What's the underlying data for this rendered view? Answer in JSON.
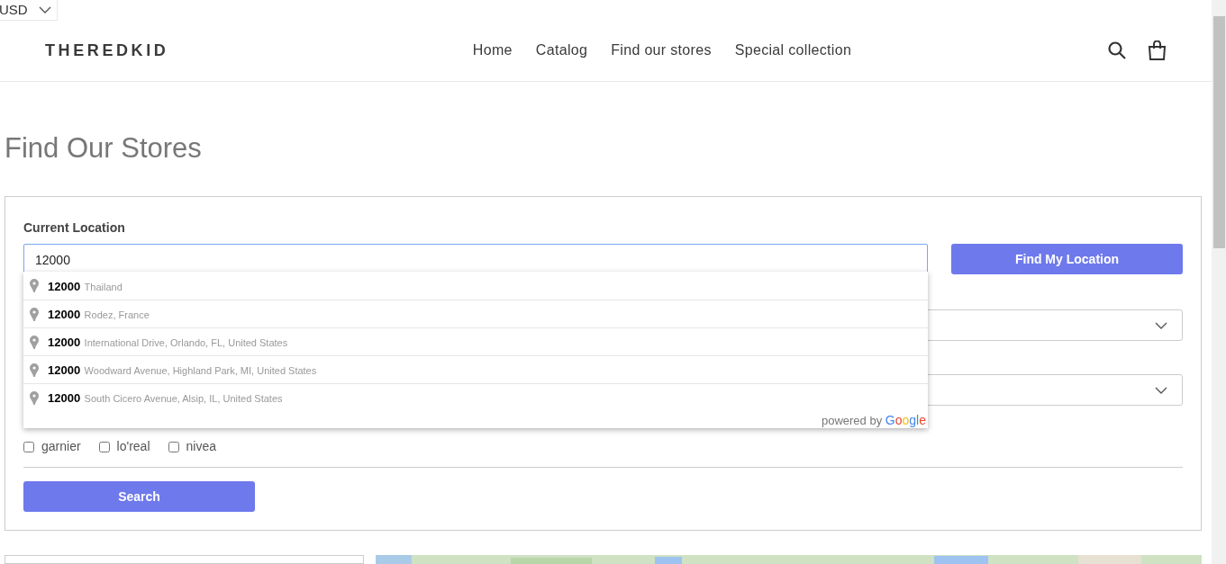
{
  "currency": {
    "value": "USD"
  },
  "header": {
    "logo": "THEREDKID",
    "nav": [
      {
        "label": "Home"
      },
      {
        "label": "Catalog"
      },
      {
        "label": "Find our stores"
      },
      {
        "label": "Special collection"
      }
    ]
  },
  "page_title": "Find Our Stores",
  "form": {
    "location_label": "Current Location",
    "location_value": "12000",
    "find_button": "Find My Location",
    "suggestions": [
      {
        "main": "12000",
        "secondary": "Thailand"
      },
      {
        "main": "12000",
        "secondary": "Rodez, France"
      },
      {
        "main": "12000",
        "secondary": "International Drive, Orlando, FL, United States"
      },
      {
        "main": "12000",
        "secondary": "Woodward Avenue, Highland Park, MI, United States"
      },
      {
        "main": "12000",
        "secondary": "South Cicero Avenue, Alsip, IL, United States"
      }
    ],
    "attribution": {
      "prefix": "powered by",
      "brand": "Google"
    },
    "brands": [
      {
        "label": "garnier",
        "checked": false
      },
      {
        "label": "lo'real",
        "checked": false
      },
      {
        "label": "nivea",
        "checked": false
      }
    ],
    "search_button": "Search"
  }
}
